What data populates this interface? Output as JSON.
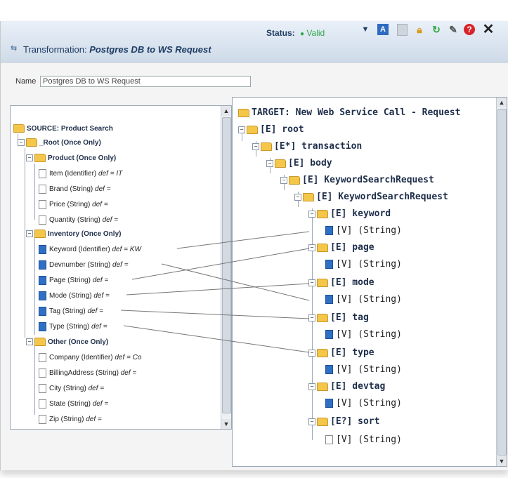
{
  "titlebar": {
    "prefix": "Transformation:",
    "name": "Postgres DB to WS Request",
    "status_label": "Status:",
    "status_value": "Valid",
    "icons": [
      "dropdown-arrow-icon",
      "a-icon",
      "save-icon",
      "lock-icon",
      "refresh-icon",
      "wand-icon",
      "help-icon",
      "close-icon"
    ]
  },
  "name_field": {
    "label": "Name",
    "value": "Postgres DB to WS Request"
  },
  "source": {
    "title": "SOURCE: Product Search",
    "root": "_Root (Once Only)",
    "product": "Product (Once Only)",
    "product_fields": [
      {
        "name": "Item (Identifier)",
        "def": "def = IT"
      },
      {
        "name": "Brand (String)",
        "def": "def ="
      },
      {
        "name": "Price (String)",
        "def": "def ="
      },
      {
        "name": "Quantity (String)",
        "def": "def ="
      }
    ],
    "inventory": "Inventory (Once Only)",
    "inventory_fields": [
      {
        "name": "Keyword (Identifier)",
        "def": "def = KW"
      },
      {
        "name": "Devnumber (String)",
        "def": "def ="
      },
      {
        "name": "Page (String)",
        "def": "def ="
      },
      {
        "name": "Mode (String)",
        "def": "def ="
      },
      {
        "name": "Tag (String)",
        "def": "def ="
      },
      {
        "name": "Type (String)",
        "def": "def ="
      }
    ],
    "other": "Other (Once Only)",
    "other_fields": [
      {
        "name": "Company (Identifier)",
        "def": "def = Co"
      },
      {
        "name": "BillingAddress (String)",
        "def": "def ="
      },
      {
        "name": "City (String)",
        "def": "def ="
      },
      {
        "name": "State (String)",
        "def": "def ="
      },
      {
        "name": "Zip (String)",
        "def": "def ="
      }
    ]
  },
  "target": {
    "title": "TARGET: New Web Service Call - Request",
    "root": "[E] root",
    "transaction": "[E*] transaction",
    "body": "[E] body",
    "ksr1": "[E] KeywordSearchRequest",
    "ksr2": "[E] KeywordSearchRequest",
    "elements": [
      {
        "name": "[E] keyword",
        "value": "[V] (String)"
      },
      {
        "name": "[E] page",
        "value": "[V] (String)"
      },
      {
        "name": "[E] mode",
        "value": "[V] (String)"
      },
      {
        "name": "[E] tag",
        "value": "[V] (String)"
      },
      {
        "name": "[E] type",
        "value": "[V] (String)"
      },
      {
        "name": "[E] devtag",
        "value": "[V] (String)"
      },
      {
        "name": "[E?] sort",
        "value": "[V] (String)"
      }
    ]
  },
  "colors": {
    "valid": "#2ea84a",
    "folder": "#f4c74a",
    "leaf_mapped": "#2f6fc4"
  }
}
